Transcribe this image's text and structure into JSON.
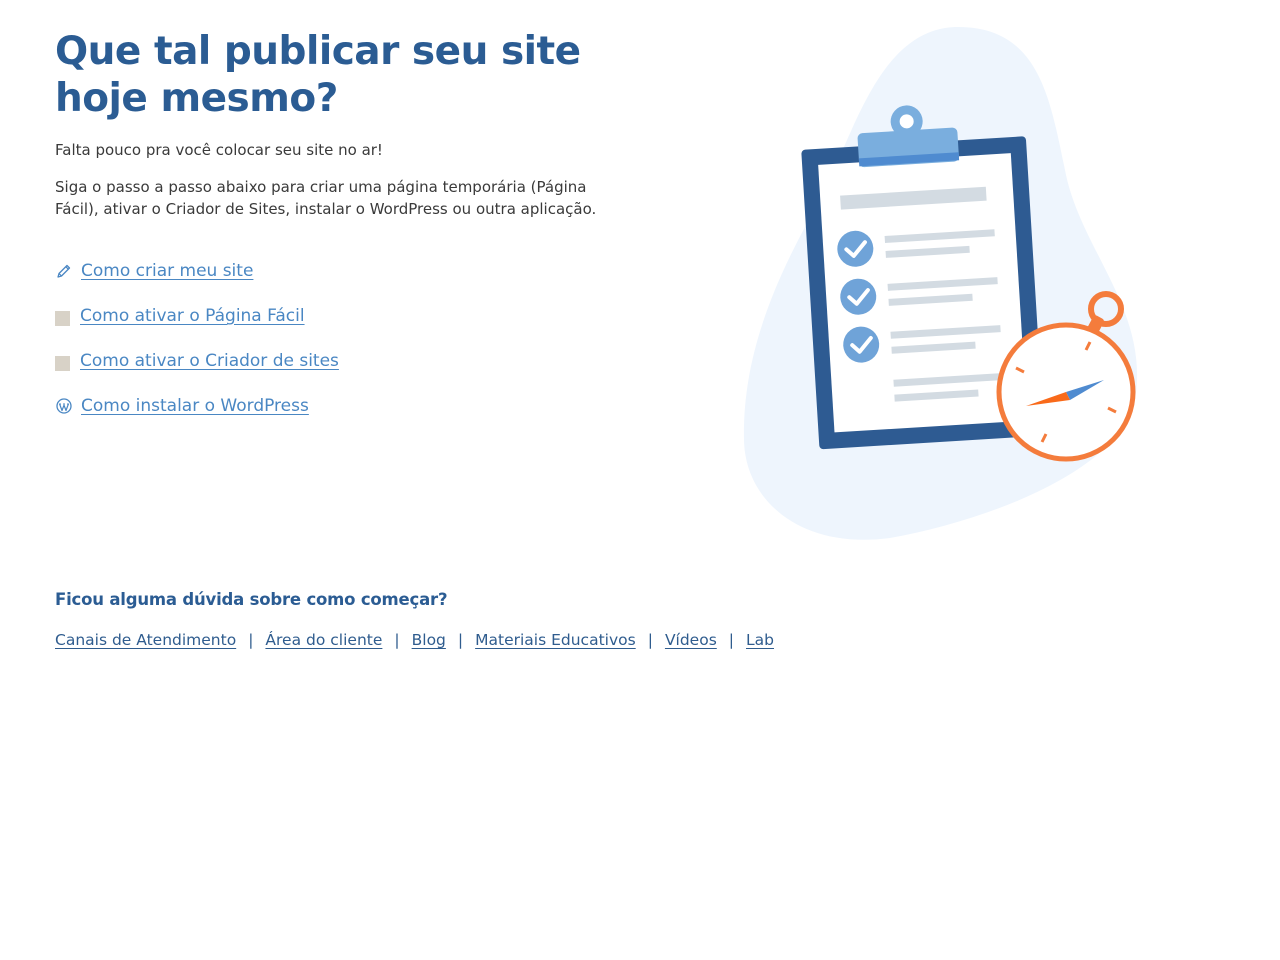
{
  "hero": {
    "title_line1": "Que tal publicar seu site",
    "title_line2": "hoje mesmo?",
    "intro": "Falta pouco pra você colocar seu site no ar!",
    "steps": "Siga o passo a passo abaixo para criar uma página temporária (Página Fácil), ativar o Criador de Sites, instalar o WordPress ou outra aplicação."
  },
  "guide_links": [
    {
      "label": "Como criar meu site",
      "icon": "pencil-icon"
    },
    {
      "label": "Como ativar o Página Fácil",
      "icon": "placeholder-icon"
    },
    {
      "label": "Como ativar o Criador de sites",
      "icon": "placeholder-icon"
    },
    {
      "label": "Como instalar o WordPress",
      "icon": "wordpress-icon"
    }
  ],
  "help": {
    "title": "Ficou alguma dúvida sobre como começar?",
    "links": [
      "Canais de Atendimento",
      "Área do cliente",
      "Blog",
      "Materiais Educativos",
      "Vídeos",
      "Lab"
    ],
    "separator": "|"
  },
  "colors": {
    "heading": "#2b5c93",
    "link": "#4a87c3",
    "footer_link": "#2f5c8e",
    "blob": "#eef5fd",
    "clipboard": "#2e5b92",
    "check": "#6fa3d8",
    "stopwatch": "#f47c3c"
  },
  "illustration": {
    "icon": "clipboard-stopwatch-illustration"
  }
}
